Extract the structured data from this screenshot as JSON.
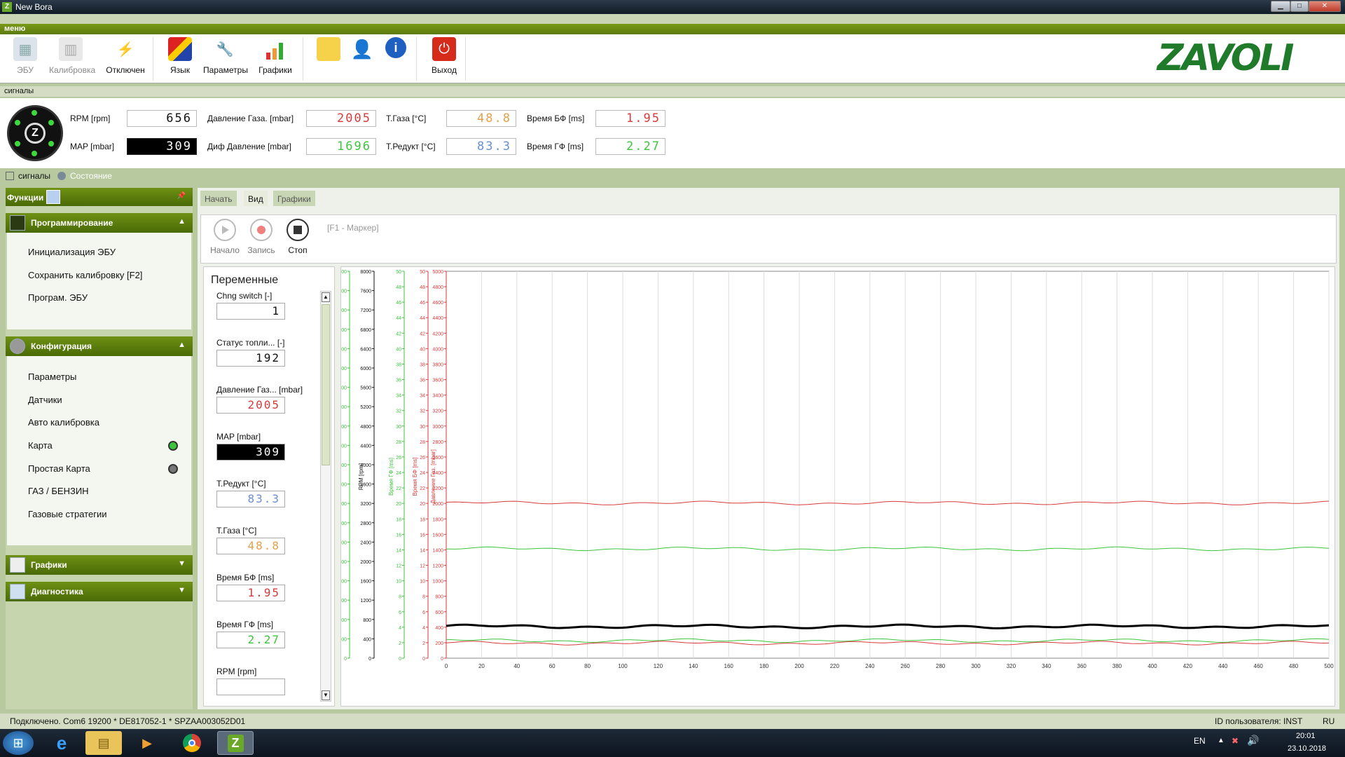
{
  "window": {
    "title": "New Bora",
    "logo": "Z"
  },
  "menu": {
    "label": "меню"
  },
  "ribbon": {
    "buttons": [
      {
        "label": "ЭБУ",
        "icon": "ecu-icon"
      },
      {
        "label": "Калибровка",
        "icon": "calibration-icon"
      },
      {
        "label": "Отключен",
        "icon": "disconnected-plug-icon"
      },
      {
        "label": "Язык",
        "icon": "language-flags-icon"
      },
      {
        "label": "Параметры",
        "icon": "wrench-icon"
      },
      {
        "label": "Графики",
        "icon": "bar-chart-icon"
      },
      {
        "label": "Выход",
        "icon": "power-icon"
      }
    ],
    "brand": "ZAVOLI"
  },
  "signals_bar": {
    "label": "сигналы"
  },
  "signals": {
    "rpm_label": "RPM [rpm]",
    "rpm_value": "656",
    "map_label": "MAP [mbar]",
    "map_value": "309",
    "gas_pressure_label": "Давление Газа. [mbar]",
    "gas_pressure_value": "2005",
    "diff_pressure_label": "Диф Давление [mbar]",
    "diff_pressure_value": "1696",
    "t_gas_label": "Т.Газа [°C]",
    "t_gas_value": "48.8",
    "t_reducer_label": "Т.Редукт [°C]",
    "t_reducer_value": "83.3",
    "time_bf_label": "Время БФ [ms]",
    "time_bf_value": "1.95",
    "time_gf_label": "Время ГФ [ms]",
    "time_gf_value": "2.27"
  },
  "subtabs": {
    "signals": "сигналы",
    "state": "Состояние"
  },
  "functions": {
    "title": "Функции",
    "sections": {
      "programming": {
        "title": "Программирование",
        "items": [
          "Инициализация ЭБУ",
          "Сохранить калибровку [F2]",
          "Програм. ЭБУ"
        ]
      },
      "configuration": {
        "title": "Конфигурация",
        "items": [
          "Параметры",
          "Датчики",
          "Авто калибровка",
          "Карта",
          "Простая Карта",
          "ГАЗ / БЕНЗИН",
          "Газовые стратегии"
        ]
      },
      "graphs": {
        "title": "Графики"
      },
      "diagnostics": {
        "title": "Диагностика"
      }
    },
    "status_colors": {
      "map_dot": "#3cc43c",
      "simple_map_dot": "#777777"
    }
  },
  "main_tabs": [
    "Начать",
    "Вид",
    "Графики"
  ],
  "toolbar": {
    "start": "Начало",
    "record": "Запись",
    "stop": "Стоп",
    "marker": "[F1 - Маркер]"
  },
  "variables": {
    "title": "Переменные",
    "items": [
      {
        "name": "Chng switch [-]",
        "value": "1",
        "color": "#111111"
      },
      {
        "name": "Статус топли... [-]",
        "value": "192",
        "color": "#111111"
      },
      {
        "name": "Давление Газ... [mbar]",
        "value": "2005",
        "color": "#d83a3a"
      },
      {
        "name": "MAP [mbar]",
        "value": "309",
        "color": "#ffffff"
      },
      {
        "name": "Т.Редукт [°C]",
        "value": "83.3",
        "color": "#6a8fd0"
      },
      {
        "name": "Т.Газа [°C]",
        "value": "48.8",
        "color": "#e7a04a"
      },
      {
        "name": "Время БФ [ms]",
        "value": "1.95",
        "color": "#d83a3a"
      },
      {
        "name": "Время ГФ [ms]",
        "value": "2.27",
        "color": "#3cc43c"
      },
      {
        "name": "RPM [rpm]",
        "value": "",
        "color": "#111111"
      }
    ]
  },
  "chart_data": {
    "type": "line",
    "x": {
      "min": 0,
      "max": 500,
      "ticks": [
        0,
        20,
        40,
        60,
        80,
        100,
        120,
        140,
        160,
        180,
        200,
        220,
        240,
        260,
        280,
        300,
        320,
        340,
        360,
        380,
        400,
        420,
        440,
        460,
        480,
        500
      ]
    },
    "axes": [
      {
        "name": "Диф Давление [mbar]",
        "color": "#3cc43c",
        "min": 0,
        "max": 6000,
        "step": 300
      },
      {
        "name": "RPM [rpm]",
        "color": "#111111",
        "min": 0,
        "max": 8000,
        "step": 400
      },
      {
        "name": "Время ГФ [ms]",
        "color": "#3cc43c",
        "min": 0,
        "max": 50,
        "step": 2
      },
      {
        "name": "Время БФ [ms]",
        "color": "#d83a3a",
        "min": 0,
        "max": 50,
        "step": 2
      },
      {
        "name": "Давление Газ. [mbar]",
        "color": "#d83a3a",
        "min": 0,
        "max": 5000,
        "step": 200
      }
    ],
    "series": [
      {
        "name": "Давление Газ. [mbar]",
        "color": "#d83a3a",
        "axis": 4,
        "value": 2005
      },
      {
        "name": "Диф Давление [mbar]",
        "color": "#3cc43c",
        "axis": 0,
        "value": 1696
      },
      {
        "name": "RPM [rpm]",
        "color": "#000000",
        "axis": 1,
        "value": 656
      },
      {
        "name": "Время ГФ [ms]",
        "color": "#3cc43c",
        "axis": 2,
        "value": 2.27
      },
      {
        "name": "Время БФ [ms]",
        "color": "#d83a3a",
        "axis": 3,
        "value": 1.95
      }
    ],
    "grid": true
  },
  "status": {
    "connection": "Подключено. Com6 19200 * DE817052-1 * SPZAA003052D01",
    "user": "ID пользователя: INST",
    "lang": "RU"
  },
  "taskbar": {
    "lang": "EN",
    "time": "20:01",
    "date": "23.10.2018"
  }
}
